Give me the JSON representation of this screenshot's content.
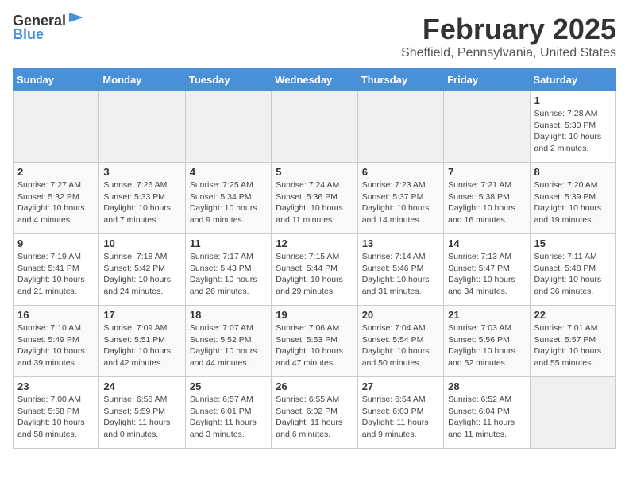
{
  "header": {
    "logo_general": "General",
    "logo_blue": "Blue",
    "title": "February 2025",
    "subtitle": "Sheffield, Pennsylvania, United States"
  },
  "weekdays": [
    "Sunday",
    "Monday",
    "Tuesday",
    "Wednesday",
    "Thursday",
    "Friday",
    "Saturday"
  ],
  "weeks": [
    [
      {
        "day": "",
        "info": ""
      },
      {
        "day": "",
        "info": ""
      },
      {
        "day": "",
        "info": ""
      },
      {
        "day": "",
        "info": ""
      },
      {
        "day": "",
        "info": ""
      },
      {
        "day": "",
        "info": ""
      },
      {
        "day": "1",
        "info": "Sunrise: 7:28 AM\nSunset: 5:30 PM\nDaylight: 10 hours\nand 2 minutes."
      }
    ],
    [
      {
        "day": "2",
        "info": "Sunrise: 7:27 AM\nSunset: 5:32 PM\nDaylight: 10 hours\nand 4 minutes."
      },
      {
        "day": "3",
        "info": "Sunrise: 7:26 AM\nSunset: 5:33 PM\nDaylight: 10 hours\nand 7 minutes."
      },
      {
        "day": "4",
        "info": "Sunrise: 7:25 AM\nSunset: 5:34 PM\nDaylight: 10 hours\nand 9 minutes."
      },
      {
        "day": "5",
        "info": "Sunrise: 7:24 AM\nSunset: 5:36 PM\nDaylight: 10 hours\nand 11 minutes."
      },
      {
        "day": "6",
        "info": "Sunrise: 7:23 AM\nSunset: 5:37 PM\nDaylight: 10 hours\nand 14 minutes."
      },
      {
        "day": "7",
        "info": "Sunrise: 7:21 AM\nSunset: 5:38 PM\nDaylight: 10 hours\nand 16 minutes."
      },
      {
        "day": "8",
        "info": "Sunrise: 7:20 AM\nSunset: 5:39 PM\nDaylight: 10 hours\nand 19 minutes."
      }
    ],
    [
      {
        "day": "9",
        "info": "Sunrise: 7:19 AM\nSunset: 5:41 PM\nDaylight: 10 hours\nand 21 minutes."
      },
      {
        "day": "10",
        "info": "Sunrise: 7:18 AM\nSunset: 5:42 PM\nDaylight: 10 hours\nand 24 minutes."
      },
      {
        "day": "11",
        "info": "Sunrise: 7:17 AM\nSunset: 5:43 PM\nDaylight: 10 hours\nand 26 minutes."
      },
      {
        "day": "12",
        "info": "Sunrise: 7:15 AM\nSunset: 5:44 PM\nDaylight: 10 hours\nand 29 minutes."
      },
      {
        "day": "13",
        "info": "Sunrise: 7:14 AM\nSunset: 5:46 PM\nDaylight: 10 hours\nand 31 minutes."
      },
      {
        "day": "14",
        "info": "Sunrise: 7:13 AM\nSunset: 5:47 PM\nDaylight: 10 hours\nand 34 minutes."
      },
      {
        "day": "15",
        "info": "Sunrise: 7:11 AM\nSunset: 5:48 PM\nDaylight: 10 hours\nand 36 minutes."
      }
    ],
    [
      {
        "day": "16",
        "info": "Sunrise: 7:10 AM\nSunset: 5:49 PM\nDaylight: 10 hours\nand 39 minutes."
      },
      {
        "day": "17",
        "info": "Sunrise: 7:09 AM\nSunset: 5:51 PM\nDaylight: 10 hours\nand 42 minutes."
      },
      {
        "day": "18",
        "info": "Sunrise: 7:07 AM\nSunset: 5:52 PM\nDaylight: 10 hours\nand 44 minutes."
      },
      {
        "day": "19",
        "info": "Sunrise: 7:06 AM\nSunset: 5:53 PM\nDaylight: 10 hours\nand 47 minutes."
      },
      {
        "day": "20",
        "info": "Sunrise: 7:04 AM\nSunset: 5:54 PM\nDaylight: 10 hours\nand 50 minutes."
      },
      {
        "day": "21",
        "info": "Sunrise: 7:03 AM\nSunset: 5:56 PM\nDaylight: 10 hours\nand 52 minutes."
      },
      {
        "day": "22",
        "info": "Sunrise: 7:01 AM\nSunset: 5:57 PM\nDaylight: 10 hours\nand 55 minutes."
      }
    ],
    [
      {
        "day": "23",
        "info": "Sunrise: 7:00 AM\nSunset: 5:58 PM\nDaylight: 10 hours\nand 58 minutes."
      },
      {
        "day": "24",
        "info": "Sunrise: 6:58 AM\nSunset: 5:59 PM\nDaylight: 11 hours\nand 0 minutes."
      },
      {
        "day": "25",
        "info": "Sunrise: 6:57 AM\nSunset: 6:01 PM\nDaylight: 11 hours\nand 3 minutes."
      },
      {
        "day": "26",
        "info": "Sunrise: 6:55 AM\nSunset: 6:02 PM\nDaylight: 11 hours\nand 6 minutes."
      },
      {
        "day": "27",
        "info": "Sunrise: 6:54 AM\nSunset: 6:03 PM\nDaylight: 11 hours\nand 9 minutes."
      },
      {
        "day": "28",
        "info": "Sunrise: 6:52 AM\nSunset: 6:04 PM\nDaylight: 11 hours\nand 11 minutes."
      },
      {
        "day": "",
        "info": ""
      }
    ]
  ]
}
